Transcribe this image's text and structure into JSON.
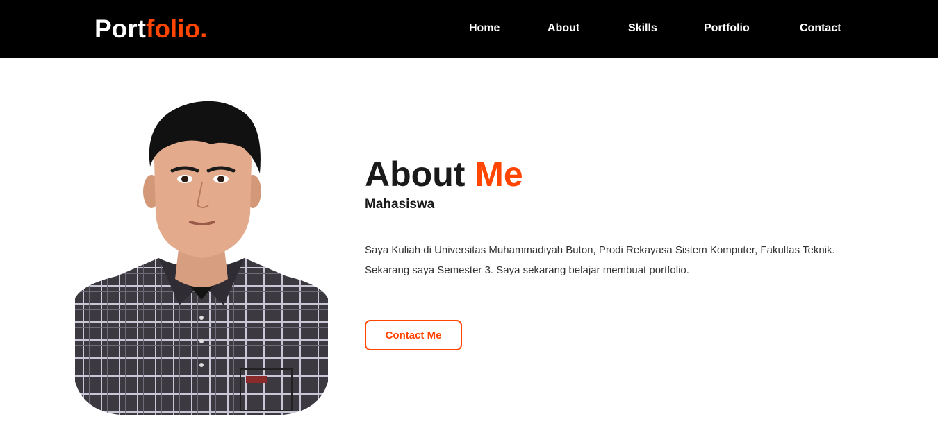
{
  "header": {
    "logo_main": "Port",
    "logo_accent": "folio.",
    "nav": {
      "home": "Home",
      "about": "About",
      "skills": "Skills",
      "portfolio": "Portfolio",
      "contact": "Contact"
    }
  },
  "about": {
    "title_main": "About ",
    "title_accent": "Me",
    "subtitle": "Mahasiswa",
    "description_line1": "Saya Kuliah di Universitas Muhammadiyah Buton, Prodi Rekayasa Sistem Komputer, Fakultas Teknik.",
    "description_line2": "Sekarang saya Semester 3. Saya sekarang belajar membuat portfolio.",
    "button_label": "Contact Me"
  },
  "colors": {
    "accent": "#ff4500",
    "navbar_bg": "#000000",
    "page_bg": "#ffffff",
    "heading": "#1a1a1a"
  },
  "icons": {
    "portrait": "profile-photo"
  }
}
